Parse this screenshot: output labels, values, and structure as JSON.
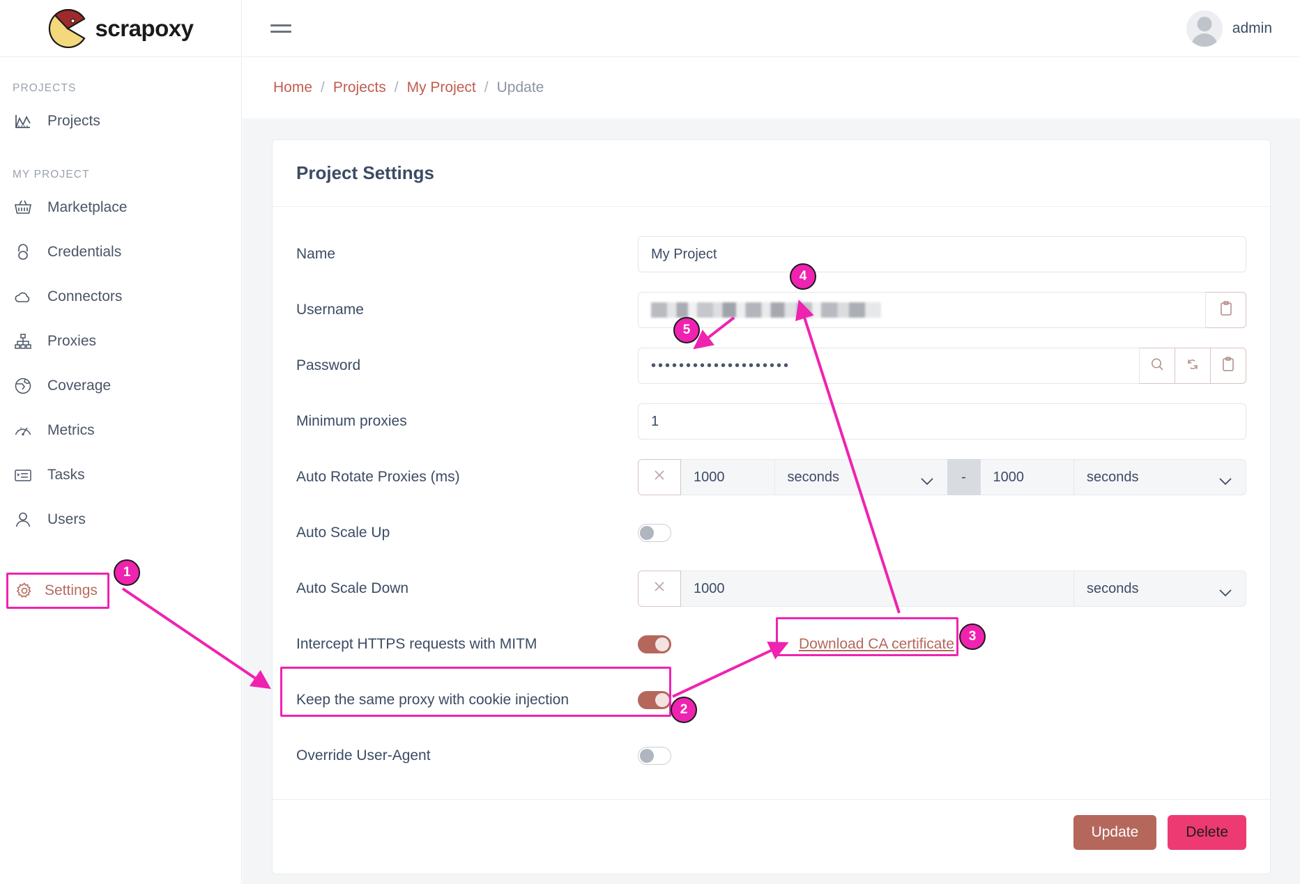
{
  "brand": {
    "name": "scrapoxy",
    "logo_icon": "pacman-logo-icon"
  },
  "sidebar": {
    "sections": [
      {
        "title": "PROJECTS",
        "items": [
          {
            "label": "Projects",
            "icon": "factory-chart-icon",
            "active": false
          }
        ]
      },
      {
        "title": "MY PROJECT",
        "items": [
          {
            "label": "Marketplace",
            "icon": "basket-icon",
            "active": false
          },
          {
            "label": "Credentials",
            "icon": "lock-icon",
            "active": false
          },
          {
            "label": "Connectors",
            "icon": "cloud-icon",
            "active": false
          },
          {
            "label": "Proxies",
            "icon": "sitemap-icon",
            "active": false
          },
          {
            "label": "Coverage",
            "icon": "globe-icon",
            "active": false
          },
          {
            "label": "Metrics",
            "icon": "gauge-icon",
            "active": false
          },
          {
            "label": "Tasks",
            "icon": "list-icon",
            "active": false
          },
          {
            "label": "Users",
            "icon": "user-icon",
            "active": false
          },
          {
            "label": "Settings",
            "icon": "gear-icon",
            "active": true
          }
        ]
      }
    ]
  },
  "topbar": {
    "menu_icon": "hamburger-icon",
    "user": "admin",
    "avatar_icon": "avatar-icon"
  },
  "breadcrumb": [
    {
      "label": "Home",
      "current": false
    },
    {
      "label": "Projects",
      "current": false
    },
    {
      "label": "My Project",
      "current": false
    },
    {
      "label": "Update",
      "current": true
    }
  ],
  "card": {
    "title": "Project Settings",
    "fields": {
      "name": {
        "label": "Name",
        "value": "My Project"
      },
      "username": {
        "label": "Username",
        "value": "",
        "masked": true,
        "copy_icon": "clipboard-icon"
      },
      "password": {
        "label": "Password",
        "value": "••••••••••••••••••••",
        "show_icon": "magnifier-icon",
        "regenerate_icon": "refresh-icon",
        "copy_icon": "clipboard-icon"
      },
      "minimum_proxies": {
        "label": "Minimum proxies",
        "value": "1"
      },
      "auto_rotate": {
        "label": "Auto Rotate Proxies (ms)",
        "clear_icon": "close-x-icon",
        "min_value": "1000",
        "min_unit": "seconds",
        "separator": "-",
        "max_value": "1000",
        "max_unit": "seconds"
      },
      "auto_scale_up": {
        "label": "Auto Scale Up",
        "enabled": false
      },
      "auto_scale_down": {
        "label": "Auto Scale Down",
        "clear_icon": "close-x-icon",
        "value": "1000",
        "unit": "seconds"
      },
      "mitm": {
        "label": "Intercept HTTPS requests with MITM",
        "enabled": true
      },
      "cookie_injection": {
        "label": "Keep the same proxy with cookie injection",
        "enabled": true
      },
      "override_ua": {
        "label": "Override User-Agent",
        "enabled": false
      }
    },
    "download_ca": "Download CA certificate",
    "actions": {
      "update": "Update",
      "delete": "Delete"
    }
  },
  "annotations": {
    "accent_color": "#ef23b0",
    "badges": [
      {
        "number": "1",
        "target": "sidebar-item-settings"
      },
      {
        "number": "2",
        "target": "cookie-injection-row"
      },
      {
        "number": "3",
        "target": "download-ca-certificate-link"
      },
      {
        "number": "4",
        "target": "username-field"
      },
      {
        "number": "5",
        "target": "password-field"
      }
    ]
  },
  "colors": {
    "accent": "#b5675c",
    "delete": "#ed3a73",
    "link": "#c15c4e",
    "annotation": "#ef23b0",
    "text": "#3c4b64",
    "muted": "#9aa2ae"
  }
}
